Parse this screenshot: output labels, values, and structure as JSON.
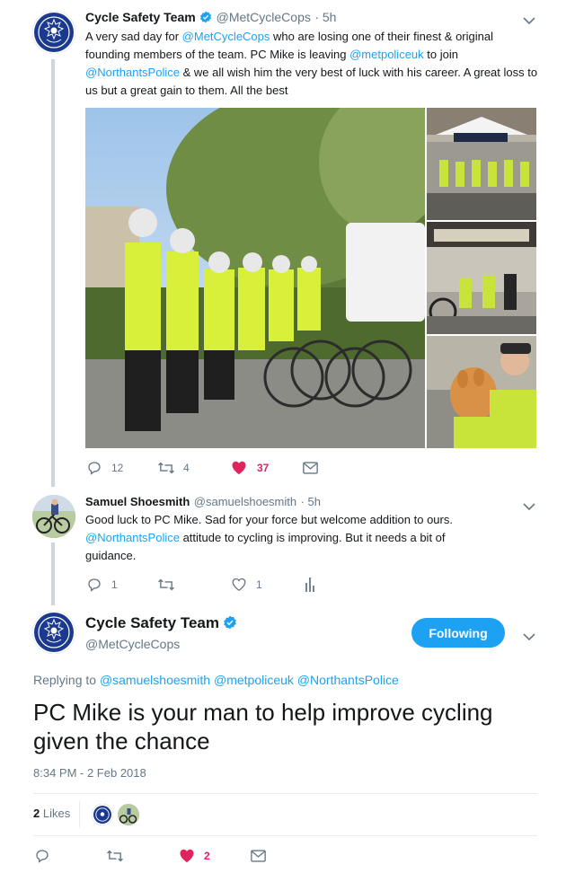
{
  "tweet1": {
    "author_name": "Cycle Safety Team",
    "author_handle": "@MetCycleCops",
    "time": "· 5h",
    "text_parts": [
      "A very sad day for ",
      "@MetCycleCops",
      " who are losing one of their finest & original founding members of the team. PC Mike is leaving ",
      "@metpoliceuk",
      " to join ",
      "@NorthantsPolice",
      " & we all wish him the very best of luck with his career. A great loss to us but a great gain to them. All the best"
    ],
    "replies": "12",
    "retweets": "4",
    "likes": "37"
  },
  "tweet2": {
    "author_name": "Samuel Shoesmith",
    "author_handle": "@samuelshoesmith",
    "time": "· 5h",
    "text_parts": [
      "Good luck to PC Mike.  Sad for your force but welcome addition to ours. ",
      "@NorthantsPolice",
      " attitude to cycling is improving.  But it needs a bit of guidance."
    ],
    "replies": "1",
    "retweets": "",
    "likes": "1"
  },
  "main_tweet": {
    "author_name": "Cycle Safety Team",
    "author_handle": "@MetCycleCops",
    "follow_label": "Following",
    "replying_label": "Replying to",
    "replying_to": [
      "@samuelshoesmith",
      "@metpoliceuk",
      "@NorthantsPolice"
    ],
    "text": "PC Mike is your man to help improve cycling given the chance",
    "timestamp": "8:34 PM - 2 Feb 2018",
    "likes_count": "2",
    "likes_label": "Likes",
    "like_action_count": "2"
  },
  "colors": {
    "accent": "#1da1f2",
    "like_red": "#e0245e",
    "muted": "#657786",
    "police_blue": "#1b3a8f"
  },
  "icons": {
    "verified": "verified-badge-icon",
    "reply": "reply-icon",
    "retweet": "retweet-icon",
    "like": "heart-icon",
    "dm": "envelope-icon",
    "analytics": "bar-chart-icon",
    "caret": "chevron-down-icon"
  }
}
